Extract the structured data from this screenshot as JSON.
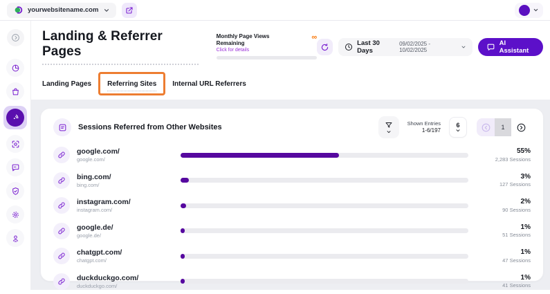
{
  "topbar": {
    "website_selector": {
      "value": "yourwebsitename.com"
    }
  },
  "sidebar": {
    "items": [
      {
        "icon": "sidebar-toggle-icon",
        "active": false
      },
      {
        "icon": "pie-chart-icon",
        "active": false
      },
      {
        "icon": "shopping-bag-icon",
        "active": false
      },
      {
        "icon": "radar-icon",
        "active": true
      },
      {
        "icon": "focus-target-icon",
        "active": false
      },
      {
        "icon": "chat-bubble-icon",
        "active": false
      },
      {
        "icon": "shield-check-icon",
        "active": false
      },
      {
        "icon": "gear-icon",
        "active": false
      },
      {
        "icon": "user-pin-icon",
        "active": false
      }
    ]
  },
  "header": {
    "title": "Landing & Referrer Pages",
    "quota": {
      "label": "Monthly Page Views Remaining",
      "link": "Click for details",
      "remaining_symbol": "∞"
    },
    "date_filter": {
      "preset": "Last 30 Days",
      "range": "09/02/2025 - 10/02/2025"
    },
    "ai_assistant_label": "AI Assistant"
  },
  "tabs": [
    {
      "label": "Landing Pages",
      "active": false
    },
    {
      "label": "Referring Sites",
      "active": true,
      "annotated": true
    },
    {
      "label": "Internal URL Referrers",
      "active": false
    }
  ],
  "panel": {
    "title": "Sessions Referred from Other Websites",
    "shown_entries_label": "Shown Entries",
    "shown_entries_value": "1-6/197",
    "page_size": "6",
    "current_page": "1"
  },
  "referrers": {
    "rows": [
      {
        "name": "google.com/",
        "path": "google.com/",
        "percent": "55%",
        "percent_value": 55,
        "sessions": "2,283 Sessions"
      },
      {
        "name": "bing.com/",
        "path": "bing.com/",
        "percent": "3%",
        "percent_value": 3,
        "sessions": "127 Sessions"
      },
      {
        "name": "instagram.com/",
        "path": "instagram.com/",
        "percent": "2%",
        "percent_value": 2,
        "sessions": "90 Sessions"
      },
      {
        "name": "google.de/",
        "path": "google.de/",
        "percent": "1%",
        "percent_value": 1,
        "sessions": "51 Sessions"
      },
      {
        "name": "chatgpt.com/",
        "path": "chatgpt.com/",
        "percent": "1%",
        "percent_value": 1,
        "sessions": "47 Sessions"
      },
      {
        "name": "duckduckgo.com/",
        "path": "duckduckgo.com/",
        "percent": "1%",
        "percent_value": 1,
        "sessions": "41 Sessions"
      }
    ]
  },
  "colors": {
    "accent_purple": "#56089f",
    "button_purple": "#5c10c9",
    "active_nav_purple": "#5a0fae",
    "annotation_orange": "#ed7d31",
    "infinity_orange": "#f9790b",
    "track_gray": "#ebebef"
  }
}
